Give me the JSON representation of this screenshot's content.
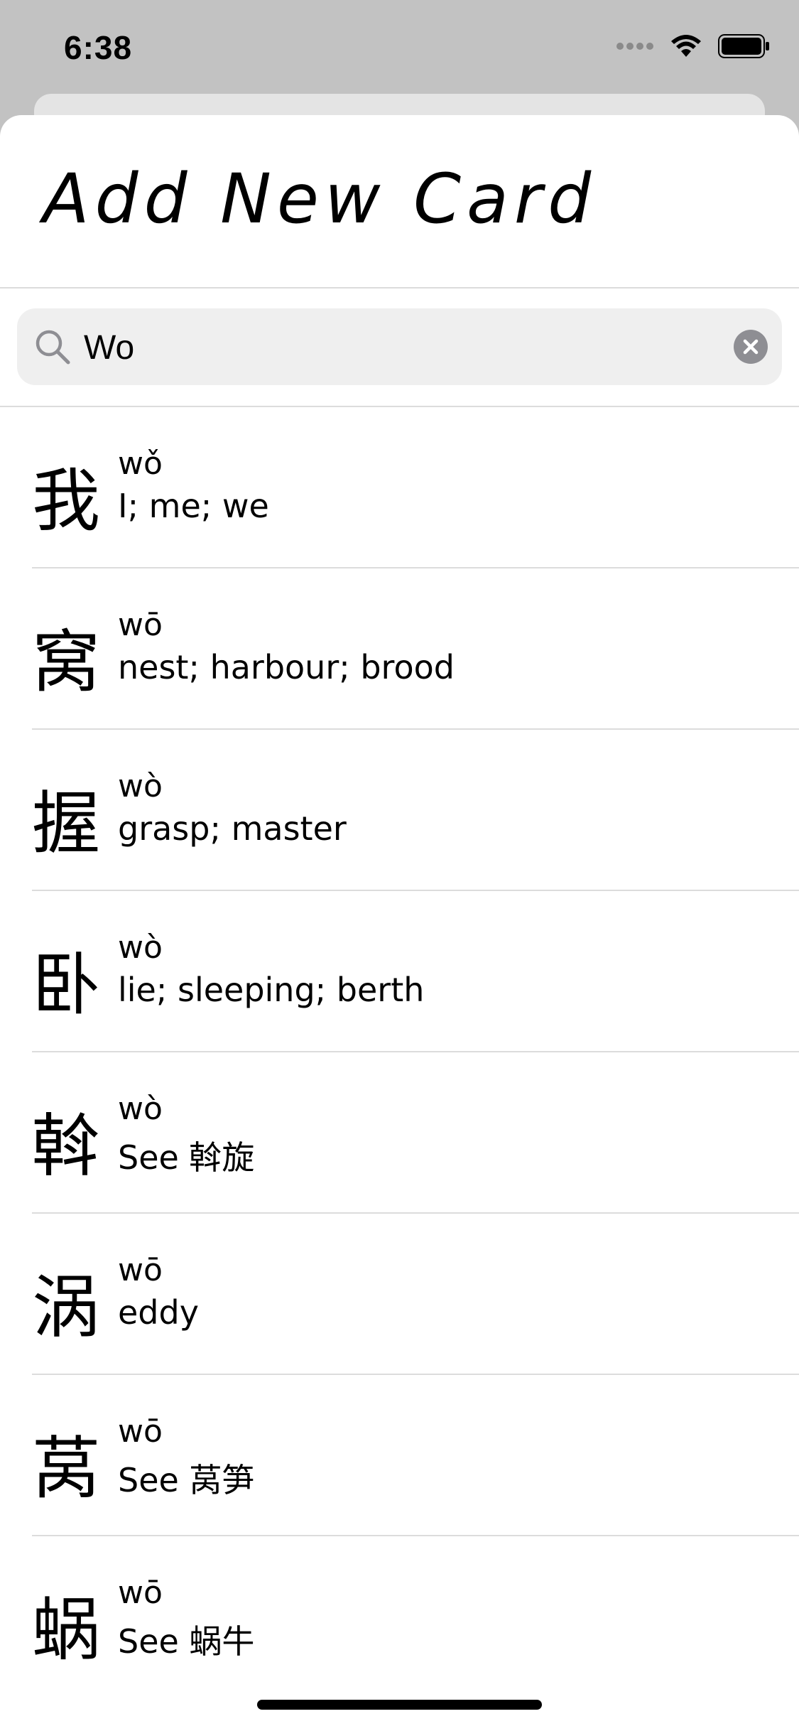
{
  "status_bar": {
    "time": "6:38",
    "icons": [
      "signal-icon",
      "wifi-icon",
      "battery-icon"
    ]
  },
  "header": {
    "title": "Add New Card"
  },
  "search": {
    "value": "Wo",
    "icon": "search-icon",
    "clear_icon": "clear-icon"
  },
  "results": [
    {
      "char": "我",
      "pinyin": "wǒ",
      "meaning": "I; me; we"
    },
    {
      "char": "窝",
      "pinyin": "wō",
      "meaning": "nest; harbour; brood"
    },
    {
      "char": "握",
      "pinyin": "wò",
      "meaning": "grasp; master"
    },
    {
      "char": "卧",
      "pinyin": "wò",
      "meaning": "lie; sleeping; berth"
    },
    {
      "char": "斡",
      "pinyin": "wò",
      "meaning": "See 斡旋"
    },
    {
      "char": "涡",
      "pinyin": "wō",
      "meaning": "eddy"
    },
    {
      "char": "莴",
      "pinyin": "wō",
      "meaning": "See 莴笋"
    },
    {
      "char": "蜗",
      "pinyin": "wō",
      "meaning": "See 蜗牛"
    }
  ]
}
